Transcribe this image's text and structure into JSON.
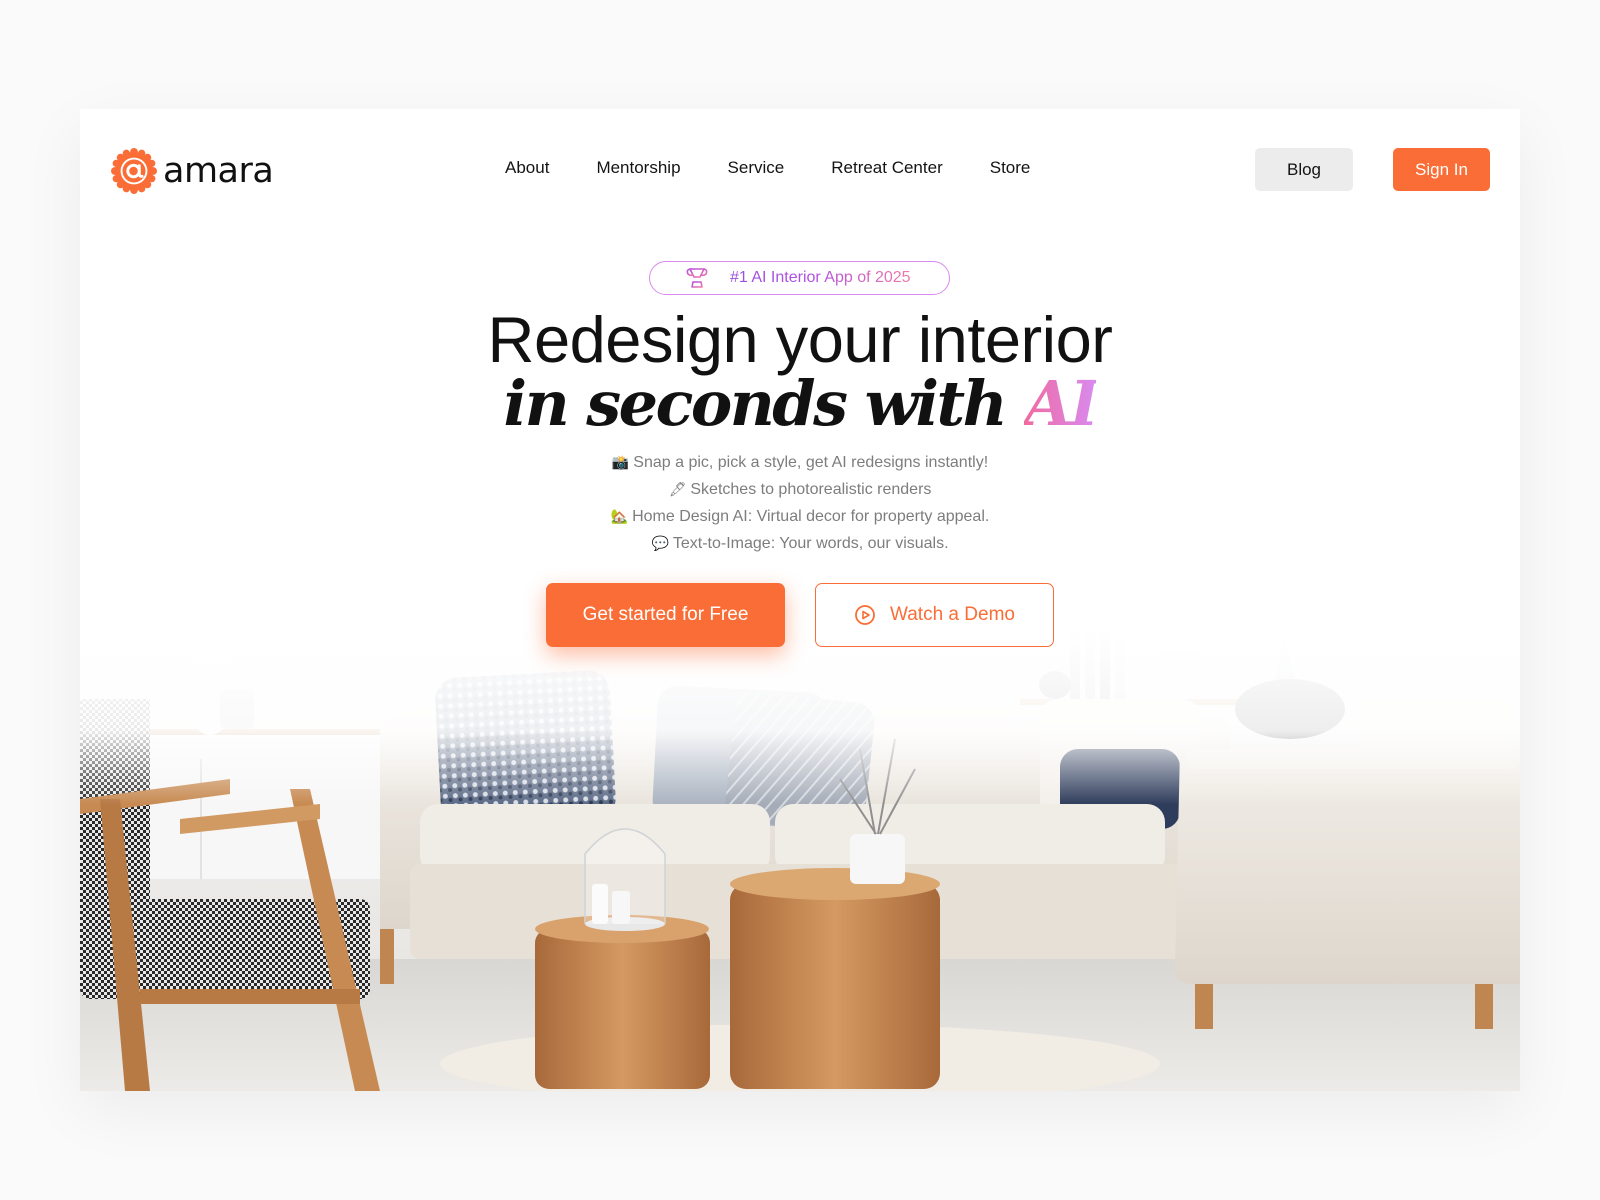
{
  "brand": {
    "name": "amara"
  },
  "nav": {
    "links": [
      "About",
      "Mentorship",
      "Service",
      "Retreat Center",
      "Store"
    ],
    "blog_label": "Blog",
    "signin_label": "Sign In"
  },
  "hero": {
    "badge": "#1 AI Interior App of 2025",
    "headline_line1": "Redesign your interior",
    "headline_line2": "in seconds with",
    "headline_highlight": "AI",
    "features": [
      {
        "emoji": "📸",
        "text": "Snap a pic, pick a style, get AI redesigns instantly!"
      },
      {
        "emoji": "🖋",
        "text": "Sketches to photorealistic renders"
      },
      {
        "emoji": "🏡",
        "text": "Home Design AI: Virtual decor for property appeal."
      },
      {
        "emoji": "💬",
        "text": "Text-to-Image: Your words, our visuals."
      }
    ],
    "cta_primary": "Get started for Free",
    "cta_secondary": "Watch a Demo"
  },
  "colors": {
    "accent": "#fa6d36",
    "badge_gradient_start": "#9b4fe0",
    "badge_gradient_end": "#f07aa8",
    "blog_button_bg": "#ececec"
  },
  "icons": {
    "logo": "at-sign-badge-icon",
    "badge": "trophy-icon",
    "demo": "play-circle-icon"
  }
}
